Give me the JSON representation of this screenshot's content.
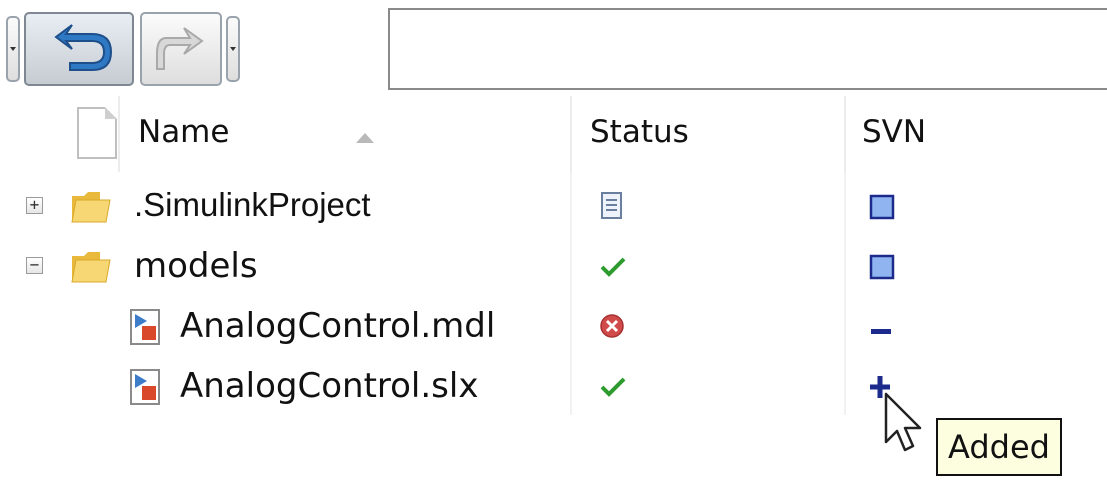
{
  "toolbar": {
    "address_value": ""
  },
  "columns": {
    "name": "Name",
    "status": "Status",
    "svn": "SVN"
  },
  "rows": [
    {
      "name": ".SimulinkProject",
      "kind": "folder",
      "expander": "+",
      "status": "document-status-icon",
      "svn": "unmodified-square-icon"
    },
    {
      "name": "models",
      "kind": "folder",
      "expander": "−",
      "status": "ok-check-icon",
      "svn": "unmodified-square-icon"
    },
    {
      "name": "AnalogControl.mdl",
      "kind": "file",
      "status": "error-x-icon",
      "svn": "deleted-minus-icon"
    },
    {
      "name": "AnalogControl.slx",
      "kind": "file",
      "status": "ok-check-icon",
      "svn": "added-plus-icon"
    }
  ],
  "tooltip": {
    "text": "Added"
  },
  "colors": {
    "svn_square": "#8fb4f0",
    "svn_blue": "#1c2a8c",
    "check_green": "#2e9b2e",
    "error_red": "#d24b4b",
    "tooltip_bg": "#fdfde0",
    "folder_yellow": "#f2cf5b"
  }
}
